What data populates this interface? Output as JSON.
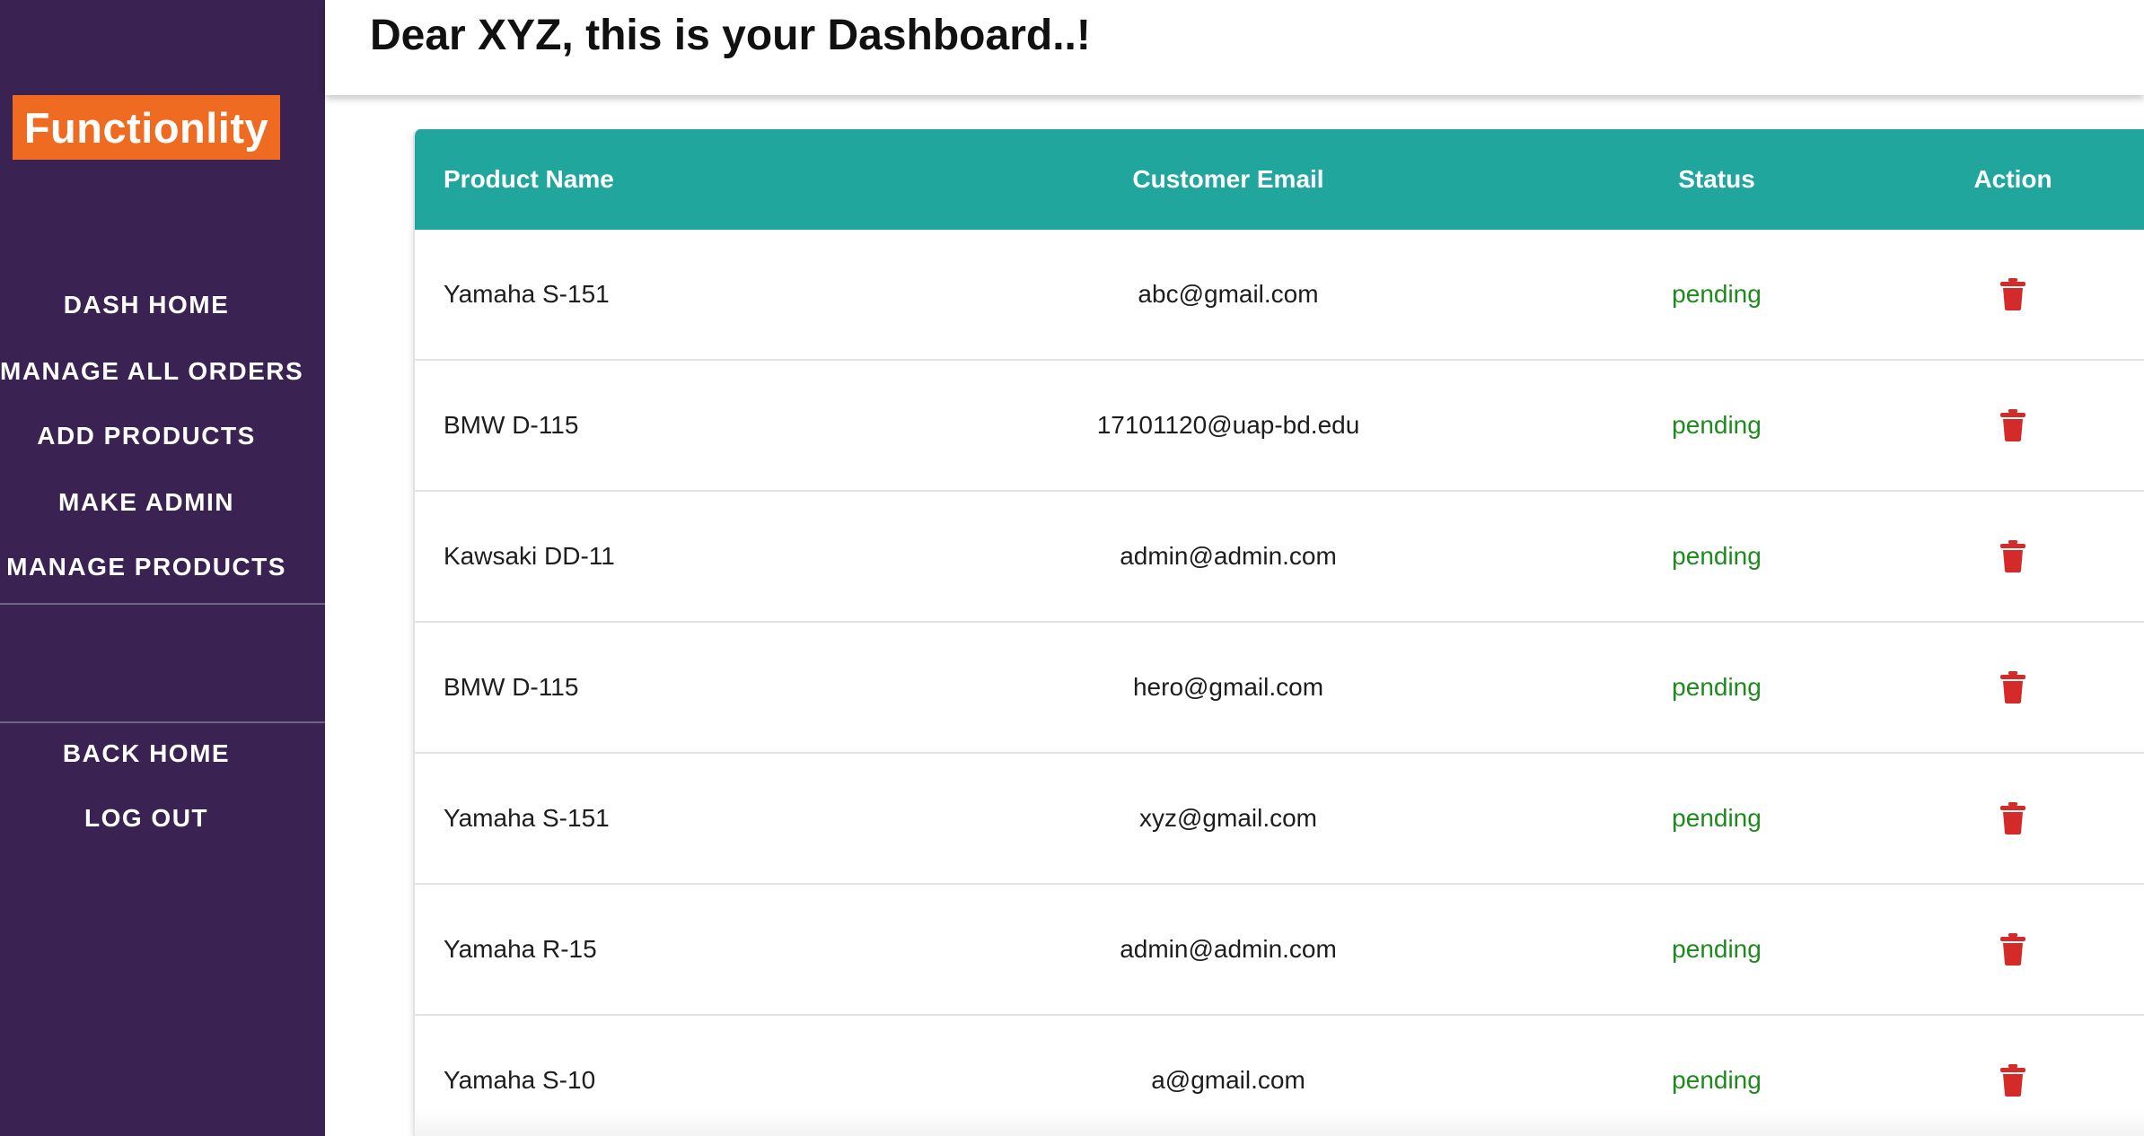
{
  "sidebar": {
    "brand": "Functionlity",
    "nav": [
      {
        "label": "DASH HOME"
      },
      {
        "label": "MANAGE ALL ORDERS"
      },
      {
        "label": "ADD PRODUCTS"
      },
      {
        "label": "MAKE ADMIN"
      },
      {
        "label": "MANAGE PRODUCTS"
      }
    ],
    "footer_nav": [
      {
        "label": "BACK HOME"
      },
      {
        "label": "LOG OUT"
      }
    ],
    "colors": {
      "background": "#3a2352",
      "brand_bg": "#ee6b21"
    }
  },
  "header": {
    "title": "Dear XYZ, this is your Dashboard..!"
  },
  "table": {
    "columns": [
      "Product Name",
      "Customer Email",
      "Status",
      "Action"
    ],
    "rows": [
      {
        "product": "Yamaha S-151",
        "email": "abc@gmail.com",
        "status": "pending",
        "action_icon": "trash-icon"
      },
      {
        "product": "BMW D-115",
        "email": "17101120@uap-bd.edu",
        "status": "pending",
        "action_icon": "trash-icon"
      },
      {
        "product": "Kawsaki DD-11",
        "email": "admin@admin.com",
        "status": "pending",
        "action_icon": "trash-icon"
      },
      {
        "product": "BMW D-115",
        "email": "hero@gmail.com",
        "status": "pending",
        "action_icon": "trash-icon"
      },
      {
        "product": "Yamaha S-151",
        "email": "xyz@gmail.com",
        "status": "pending",
        "action_icon": "trash-icon"
      },
      {
        "product": "Yamaha R-15",
        "email": "admin@admin.com",
        "status": "pending",
        "action_icon": "trash-icon"
      },
      {
        "product": "Yamaha S-10",
        "email": "a@gmail.com",
        "status": "pending",
        "action_icon": "trash-icon"
      }
    ],
    "colors": {
      "header_bg": "#21a69d",
      "status": "#1e8a1e",
      "delete": "#d42a2a"
    }
  }
}
